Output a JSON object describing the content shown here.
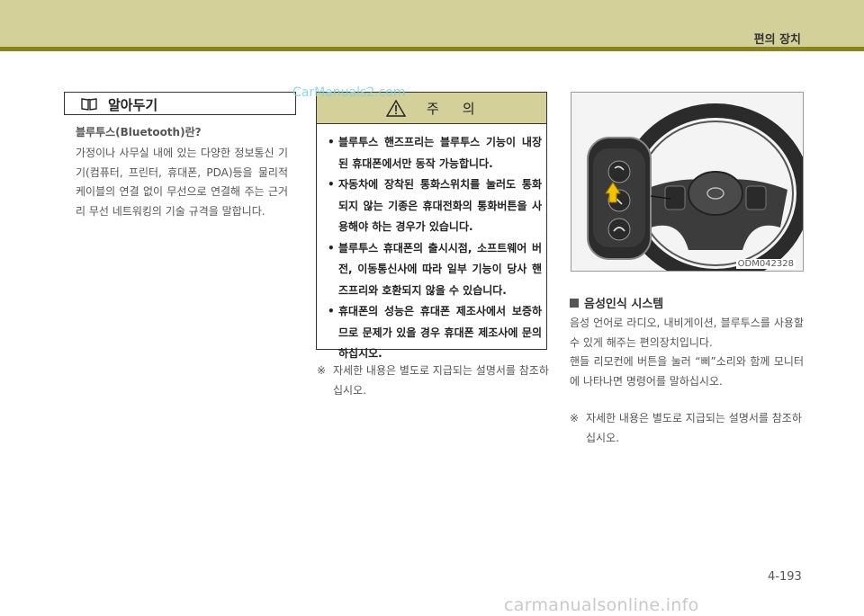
{
  "header": {
    "title": "편의 장치"
  },
  "watermark_top": "CarManuals2.com",
  "watermark_bottom": "carmanualsonline.info",
  "tip": {
    "icon": "book-icon",
    "title": "알아두기",
    "subtitle": "블루투스(Bluetooth)란?",
    "body": "가정이나 사무실 내에 있는 다양한 정보통신 기기(컴퓨터, 프린터, 휴대폰, PDA)등을 물리적 케이블의 연결 없이 무선으로 연결해 주는 근거리 무선 네트워킹의 기술 규격을 말합니다."
  },
  "caution": {
    "icon": "warning-triangle-icon",
    "title": "주의",
    "items": [
      "블루투스 핸즈프리는 블루투스 기능이 내장된 휴대폰에서만 동작 가능합니다.",
      "자동차에 장착된 통화스위치를 눌러도 통화 되지 않는 기종은 휴대전화의 통화버튼을 사용해야 하는 경우가 있습니다.",
      "블루투스 휴대폰의 출시시점, 소프트웨어 버전, 이동통신사에 따라 일부 기능이 당사 핸즈프리와 호환되지 않을 수 있습니다.",
      "휴대폰의 성능은 휴대폰 제조사에서 보증하므로 문제가 있을 경우 휴대폰 제조사에 문의 하십시오."
    ]
  },
  "note_mark": "※",
  "note_text": "자세한 내용은 별도로 지급되는 설명서를 참조하십시오.",
  "photo": {
    "label": "ODM042328"
  },
  "voice": {
    "heading": "음성인식 시스템",
    "body1": "음성 언어로 라디오, 내비게이션, 블루투스를 사용할 수 있게 해주는 편의장치입니다.",
    "body2": "핸들 리모컨에 버튼을 눌러 “삐”소리와 함께 모니터에 나타나면 명령어를 말하십시오."
  },
  "page_number": "4-193"
}
